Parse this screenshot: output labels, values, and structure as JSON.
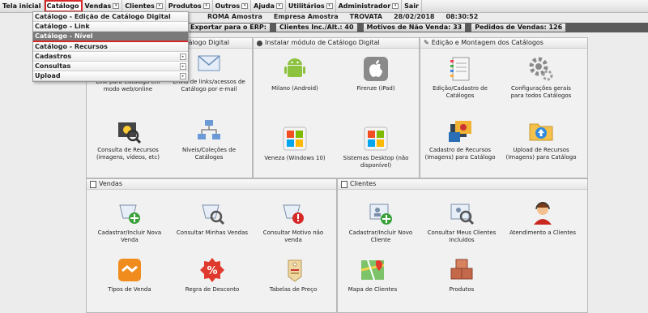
{
  "menubar": {
    "items": [
      {
        "label": "Tela inicial"
      },
      {
        "label": "Catálogo"
      },
      {
        "label": "Vendas"
      },
      {
        "label": "Clientes"
      },
      {
        "label": "Produtos"
      },
      {
        "label": "Outros"
      },
      {
        "label": "Ajuda"
      },
      {
        "label": "Utilitários"
      },
      {
        "label": "Administrador"
      },
      {
        "label": "Sair"
      }
    ]
  },
  "dropdown": {
    "items": [
      {
        "label": "Catálogo - Edição de Catálogo Digital"
      },
      {
        "label": "Catálogo - Link"
      },
      {
        "label": "Catálogo - Nível"
      },
      {
        "label": "Catálogo - Recursos"
      },
      {
        "label": "Cadastros"
      },
      {
        "label": "Consultas"
      },
      {
        "label": "Upload"
      }
    ]
  },
  "status": {
    "user": "ROMA Amostra",
    "company": "Empresa Amostra",
    "app": "TROVATA",
    "date": "28/02/2018",
    "time": "08:30:52"
  },
  "info": {
    "export": "Exportar para o ERP:",
    "clients": "Clientes Inc./Alt.: 40",
    "reasons": "Motivos de Não Venda: 33",
    "orders": "Pedidos de Vendas: 126"
  },
  "panels": {
    "catalog": {
      "title": "Catálogo Digital",
      "tiles": [
        {
          "label": "Link para Catálogo em modo web/online"
        },
        {
          "label": "Envio de links/acessos de Catálogo por e-mail"
        },
        {
          "label": "Consulta de Recursos (imagens, vídeos, etc)"
        },
        {
          "label": "Níveis/Coleções de Catálogos"
        }
      ]
    },
    "install": {
      "title": "Instalar módulo de Catálogo Digital",
      "tiles": [
        {
          "label": "Milano (Android)"
        },
        {
          "label": "Firenze (iPad)"
        },
        {
          "label": "Veneza (Windows 10)"
        },
        {
          "label": "Sistemas Desktop (não disponível)"
        }
      ]
    },
    "edit": {
      "title": "Edição e Montagem dos Catálogos",
      "tiles": [
        {
          "label": "Edição/Cadastro de Catálogos"
        },
        {
          "label": "Configurações gerais para todos Catálogos"
        },
        {
          "label": "Cadastro de Recursos (Imagens) para Catálogo"
        },
        {
          "label": "Upload de Recursos (Imagens) para Catálogo"
        }
      ]
    },
    "sales": {
      "title": "Vendas",
      "tiles": [
        {
          "label": "Cadastrar/Incluir Nova Venda"
        },
        {
          "label": "Consultar Minhas Vendas"
        },
        {
          "label": "Consultar Motivo não venda"
        },
        {
          "label": "Tipos de Venda"
        },
        {
          "label": "Regra de Desconto"
        },
        {
          "label": "Tabelas de Preço"
        }
      ]
    },
    "clients": {
      "title": "Clientes",
      "tiles": [
        {
          "label": "Cadastrar/Incluir Novo Cliente"
        },
        {
          "label": "Consultar Meus Clientes Incluídos"
        },
        {
          "label": "Atendimento a Clientes"
        },
        {
          "label": "Mapa de Clientes"
        },
        {
          "label": "Produtos"
        }
      ]
    }
  },
  "colors": {
    "accent": "#d62a2a",
    "highlight": "#7a7a7a",
    "green": "#3aa13a"
  }
}
